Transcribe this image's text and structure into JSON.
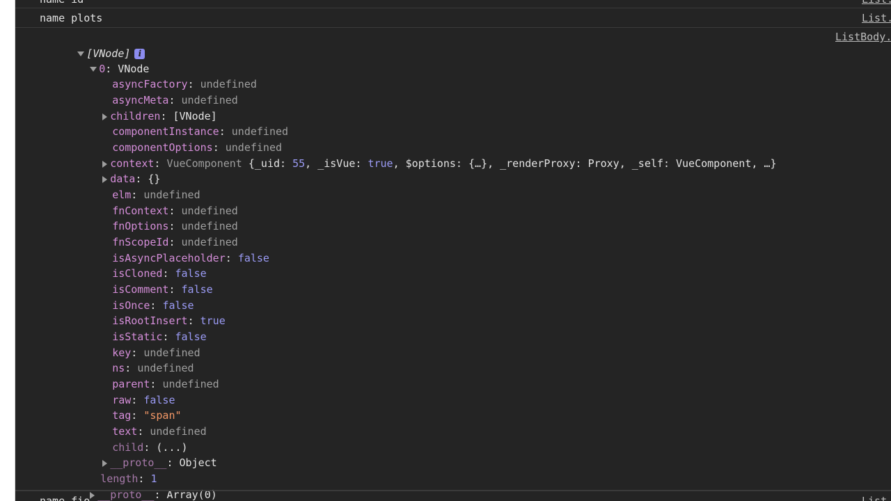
{
  "messages": {
    "top": {
      "text": "name id",
      "source": "List."
    },
    "second": {
      "text": "name plots",
      "source": "List."
    },
    "bottom": {
      "text": "name fio",
      "source": "List."
    }
  },
  "object": {
    "source": "ListBody.",
    "header": "[VNode]",
    "info_glyph": "i",
    "item0_index": "0",
    "item0_type": "VNode",
    "props": {
      "asyncFactory": {
        "key": "asyncFactory",
        "value": "undefined"
      },
      "asyncMeta": {
        "key": "asyncMeta",
        "value": "undefined"
      },
      "children": {
        "key": "children",
        "value": "[VNode]"
      },
      "componentInstance": {
        "key": "componentInstance",
        "value": "undefined"
      },
      "componentOptions": {
        "key": "componentOptions",
        "value": "undefined"
      },
      "context": {
        "key": "context",
        "class": "VueComponent",
        "open": " {",
        "k1": "_uid",
        "v1": "55",
        "k2": "_isVue",
        "v2": "true",
        "k3": "$options",
        "v3": "{…}",
        "k4": "_renderProxy",
        "v4": "Proxy",
        "k5": "_self",
        "v5": "VueComponent",
        "close": ", …}"
      },
      "data": {
        "key": "data",
        "value": "{}"
      },
      "elm": {
        "key": "elm",
        "value": "undefined"
      },
      "fnContext": {
        "key": "fnContext",
        "value": "undefined"
      },
      "fnOptions": {
        "key": "fnOptions",
        "value": "undefined"
      },
      "fnScopeId": {
        "key": "fnScopeId",
        "value": "undefined"
      },
      "isAsyncPlaceholder": {
        "key": "isAsyncPlaceholder",
        "value": "false"
      },
      "isCloned": {
        "key": "isCloned",
        "value": "false"
      },
      "isComment": {
        "key": "isComment",
        "value": "false"
      },
      "isOnce": {
        "key": "isOnce",
        "value": "false"
      },
      "isRootInsert": {
        "key": "isRootInsert",
        "value": "true"
      },
      "isStatic": {
        "key": "isStatic",
        "value": "false"
      },
      "key": {
        "key": "key",
        "value": "undefined"
      },
      "ns": {
        "key": "ns",
        "value": "undefined"
      },
      "parent": {
        "key": "parent",
        "value": "undefined"
      },
      "raw": {
        "key": "raw",
        "value": "false"
      },
      "tag": {
        "key": "tag",
        "value": "\"span\""
      },
      "text": {
        "key": "text",
        "value": "undefined"
      },
      "child": {
        "key": "child",
        "value": "(...)"
      },
      "proto": {
        "key": "__proto__",
        "value": "Object"
      }
    },
    "length": {
      "key": "length",
      "value": "1"
    },
    "array_proto": {
      "key": "__proto__",
      "value": "Array(0)"
    }
  },
  "colors": {
    "background": "#242424",
    "key": "#d58ed9",
    "undefined": "#a0a0a0",
    "boolean": "#9b9bf5",
    "string": "#f29766"
  }
}
